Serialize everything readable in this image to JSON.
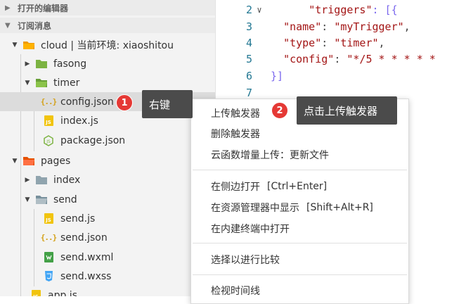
{
  "explorer": {
    "open_editors_label": "打开的编辑器",
    "project_label": "订阅消息",
    "items": [
      {
        "label": "cloud | 当前环境: xiaoshitou"
      },
      {
        "label": "fasong"
      },
      {
        "label": "timer"
      },
      {
        "label": "config.json"
      },
      {
        "label": "index.js"
      },
      {
        "label": "package.json"
      },
      {
        "label": "pages"
      },
      {
        "label": "index"
      },
      {
        "label": "send"
      },
      {
        "label": "send.js"
      },
      {
        "label": "send.json"
      },
      {
        "label": "send.wxml"
      },
      {
        "label": "send.wxss"
      },
      {
        "label": "app.js"
      }
    ]
  },
  "editor": {
    "lines": [
      {
        "num": "2",
        "key": "\"triggers\"",
        "rest": ": [{"
      },
      {
        "num": "3",
        "key": "\"name\"",
        "rest": ": ",
        "value": "\"myTrigger\"",
        "tail": ","
      },
      {
        "num": "4",
        "key": "\"type\"",
        "rest": ": ",
        "value": "\"timer\"",
        "tail": ","
      },
      {
        "num": "5",
        "key": "\"config\"",
        "rest": ": ",
        "value": "\"*/5 * * * * *",
        "tail": ""
      },
      {
        "num": "6",
        "text": "}]"
      },
      {
        "num": "7",
        "text": ""
      }
    ]
  },
  "context_menu": {
    "items": [
      {
        "label": "上传触发器"
      },
      {
        "label": "删除触发器"
      },
      {
        "label": "云函数增量上传：更新文件"
      },
      {
        "label": "在侧边打开",
        "shortcut": "[Ctrl+Enter]"
      },
      {
        "label": "在资源管理器中显示",
        "shortcut": "[Shift+Alt+R]"
      },
      {
        "label": "在内建终端中打开"
      },
      {
        "label": "选择以进行比较"
      },
      {
        "label": "检视时间线"
      }
    ]
  },
  "annotations": {
    "step1": {
      "number": "1",
      "text": "右键"
    },
    "step2": {
      "number": "2",
      "text": "点击上传触发器"
    }
  },
  "colors": {
    "annotation_red": "#e53935",
    "tooltip_bg": "#4b4b4b",
    "folder_green": "#7cb342",
    "folder_orange": "#ef6c00",
    "folder_gray": "#90a4ae",
    "js_yellow": "#f1c40f"
  }
}
